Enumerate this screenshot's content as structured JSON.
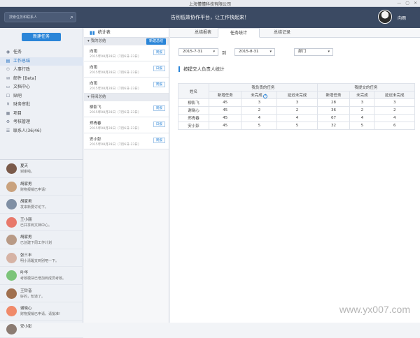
{
  "window": {
    "title": "上海懂懂科技有限公司",
    "controls": [
      "—",
      "▢",
      "✕"
    ]
  },
  "topbar": {
    "search_placeholder": "搜索任务和联系人",
    "slogan": "告别低效协作平台，让工作快起来！",
    "user_name": "向雨"
  },
  "sidebar": {
    "new_task_label": "新建任务",
    "nav": [
      {
        "label": "任务",
        "icon": "target-icon",
        "glyph": "◉",
        "active": false
      },
      {
        "label": "工作总结",
        "icon": "document-icon",
        "glyph": "▤",
        "active": true
      },
      {
        "label": "人事行政",
        "icon": "person-icon",
        "glyph": "⚇",
        "active": false
      },
      {
        "label": "邮件 [Beta]",
        "icon": "mail-icon",
        "glyph": "✉",
        "active": false
      },
      {
        "label": "文档中心",
        "icon": "folder-icon",
        "glyph": "▭",
        "active": false
      },
      {
        "label": "贴吧",
        "icon": "chat-icon",
        "glyph": "☐",
        "active": false
      },
      {
        "label": "财务审批",
        "icon": "money-icon",
        "glyph": "¥",
        "active": false
      },
      {
        "label": "项目",
        "icon": "grid-icon",
        "glyph": "▦",
        "active": false
      },
      {
        "label": "考核管理",
        "icon": "gear-icon",
        "glyph": "⚙",
        "active": false
      },
      {
        "label": "联系人(36/46)",
        "icon": "contacts-icon",
        "glyph": "☰",
        "active": false
      }
    ],
    "chats": [
      {
        "name": "夏天",
        "msg": "谢谢啦。",
        "color": "#7a5a4a"
      },
      {
        "name": "胡家男",
        "msg": "财物报销已申请!",
        "color": "#c9a27e"
      },
      {
        "name": "胡家男",
        "msg": "发来新要讨论下。",
        "color": "#7f8fa4"
      },
      {
        "name": "王小丽",
        "msg": "已共享到文档中心。",
        "color": "#e8796b"
      },
      {
        "name": "胡家男",
        "msg": "已创建下周工作计划",
        "color": "#b89a86"
      },
      {
        "name": "张三丰",
        "msg": "明小清醒支到别吧一下。",
        "color": "#d6b3a5"
      },
      {
        "name": "叶华",
        "msg": "考核模块已增加到成员考核。",
        "color": "#7cc47a"
      },
      {
        "name": "王铃音",
        "msg": "好的，知道了。",
        "color": "#a0704f"
      },
      {
        "name": "谢晓心",
        "msg": "财物报销已申请，请批准!",
        "color": "#f08a6a"
      },
      {
        "name": "安小彭",
        "msg": "",
        "color": "#8b7b72"
      }
    ]
  },
  "middle": {
    "header": "统计表",
    "my_section": "我的总结",
    "new_summary_btn": "新建总结",
    "my_entries": [
      {
        "name": "向雨",
        "date": "2015年08月28日（7月6日-23日）",
        "btn": "周报"
      },
      {
        "name": "向雨",
        "date": "2015年08月28日（7月6日-23日）",
        "btn": "日报"
      },
      {
        "name": "向雨",
        "date": "2015年08月28日（7月6日-23日）",
        "btn": "周报"
      }
    ],
    "recv_section": "待阅总结",
    "recv_entries": [
      {
        "name": "柳影飞",
        "date": "2015年08月28日（7月6日-23日）",
        "btn": "周报"
      },
      {
        "name": "郑青春",
        "date": "2015年08月28日（7月6日-23日）",
        "btn": "日报"
      },
      {
        "name": "安小彭",
        "date": "2015年08月28日（7月6日-23日）",
        "btn": "周报"
      }
    ]
  },
  "main": {
    "tabs": [
      "总结报表",
      "任务统计",
      "总结记录"
    ],
    "active_tab": 1,
    "date_from": "2015-7-31",
    "to_label": "到",
    "date_to": "2015-8-31",
    "dept": "部门",
    "stat_title": "按提交人负责人统计",
    "table": {
      "name_header": "姓名",
      "group1": "我负责的任务",
      "group2": "我提交的任务",
      "sub_headers": [
        "新增任务",
        "未完成",
        "延迟未完成",
        "新增任务",
        "未完成",
        "延迟未完成"
      ],
      "rows": [
        {
          "name": "柳影飞",
          "vals": [
            "45",
            "3",
            "3",
            "28",
            "3",
            "3"
          ]
        },
        {
          "name": "谢晓心",
          "vals": [
            "45",
            "2",
            "2",
            "36",
            "2",
            "2"
          ]
        },
        {
          "name": "郑青春",
          "vals": [
            "45",
            "4",
            "4",
            "67",
            "4",
            "4"
          ]
        },
        {
          "name": "安小彭",
          "vals": [
            "45",
            "5",
            "5",
            "32",
            "5",
            "6"
          ]
        }
      ]
    }
  },
  "watermark": "www.yx007.com"
}
